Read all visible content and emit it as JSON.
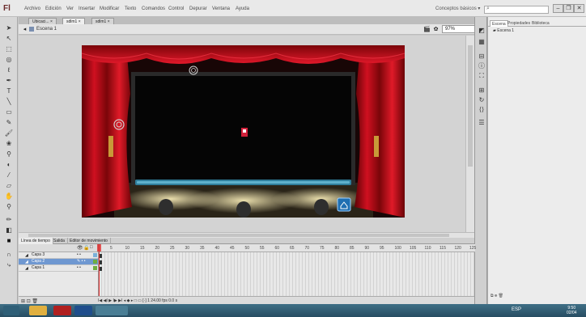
{
  "app": {
    "logo": "Fl",
    "menu": [
      "Archivo",
      "Edición",
      "Ver",
      "Insertar",
      "Modificar",
      "Texto",
      "Comandos",
      "Control",
      "Depurar",
      "Ventana",
      "Ayuda"
    ],
    "workspace": "Conceptos básicos ▾",
    "search_icon": "⌕",
    "window_buttons": [
      "–",
      "❐",
      "✕"
    ]
  },
  "doc_tabs": [
    "Ubicaci... ×",
    "sdlm1 ×",
    "sdlm1 ×"
  ],
  "edit_bar": {
    "scene": "Escena 1",
    "zoom": "97%"
  },
  "right_panel": {
    "tabs": [
      "Escena",
      "Propiedades",
      "Biblioteca"
    ],
    "item": "Escena 1"
  },
  "timeline": {
    "tabs": [
      "Línea de tiempo",
      "Salida",
      "Editor de movimiento"
    ],
    "ruler_ticks": [
      "5",
      "10",
      "15",
      "20",
      "25",
      "30",
      "35",
      "40",
      "45",
      "50",
      "55",
      "60",
      "65",
      "70",
      "75",
      "80",
      "85",
      "90",
      "95",
      "100",
      "105",
      "110",
      "115",
      "120",
      "125"
    ],
    "layers": [
      {
        "name": "Capa 3",
        "dots": "•  •",
        "selected": false,
        "color": "#7ab0d9"
      },
      {
        "name": "Capa 2",
        "dots": "✎  •  •",
        "selected": true,
        "color": "#6fae3f"
      },
      {
        "name": "Capa 1",
        "dots": "•  •",
        "selected": false,
        "color": "#6fae3f"
      }
    ],
    "status": "1",
    "controls": "I◀ ◀I ▶ I▶ ▶I    ◂ ◆ ▸ □ ▭ [·]    1    24.00 fps    0.0 s"
  },
  "taskbar": {
    "tray_text": "ESP",
    "clock": [
      "9:50",
      "02/04"
    ]
  },
  "colors": {
    "stage_bg": "#160505",
    "curtain": "#c8101a",
    "screen": "#050505",
    "screen_frame": "#262626",
    "teal_bar": "#2f7d9a"
  }
}
